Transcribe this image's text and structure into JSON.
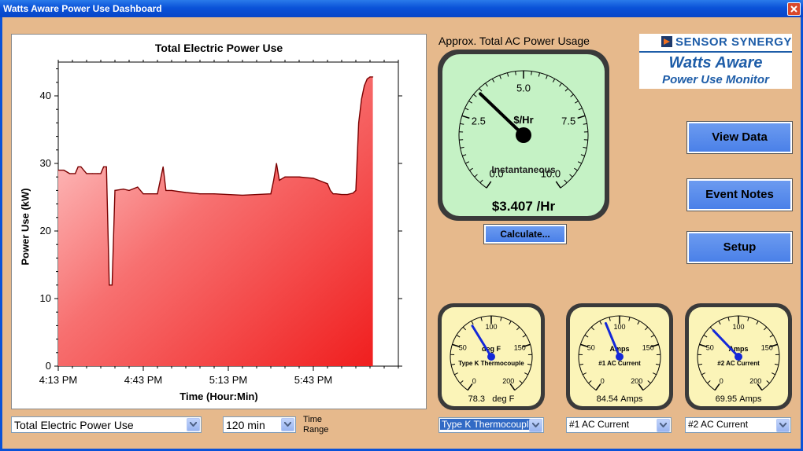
{
  "window": {
    "title": "Watts Aware Power Use Dashboard"
  },
  "chart_data": {
    "type": "area",
    "title": "Total Electric Power Use",
    "xlabel": "Time (Hour:Min)",
    "ylabel": "Power Use (kW)",
    "xticks": [
      "4:13 PM",
      "4:43 PM",
      "5:13 PM",
      "5:43 PM"
    ],
    "yticks": [
      "0",
      "10",
      "20",
      "30",
      "40"
    ],
    "ylim": [
      0,
      45
    ],
    "xlim": [
      0,
      120
    ],
    "grid": false,
    "x": [
      0,
      2,
      4,
      6,
      7,
      8,
      10,
      12,
      14,
      15,
      16,
      17,
      18,
      19,
      20,
      23,
      25,
      28,
      30,
      35,
      37,
      38,
      40,
      45,
      50,
      55,
      60,
      65,
      70,
      75,
      76,
      77,
      78,
      80,
      85,
      90,
      95,
      96,
      97,
      98,
      100,
      102,
      104,
      105,
      106,
      107,
      108,
      109,
      110,
      111
    ],
    "y": [
      29,
      29,
      28.5,
      28.5,
      29.5,
      29.5,
      28.5,
      28.5,
      28.5,
      28.5,
      29.5,
      29.5,
      12,
      12,
      26,
      26.2,
      26,
      26.5,
      25.5,
      25.5,
      29.5,
      26,
      26,
      25.7,
      25.5,
      25.5,
      25.4,
      25.3,
      25.4,
      25.5,
      27.5,
      30,
      27.5,
      28,
      28,
      27.8,
      27,
      26,
      25.5,
      25.5,
      25.4,
      25.4,
      25.6,
      26,
      36,
      39.5,
      41.5,
      42.5,
      42.8,
      42.8
    ]
  },
  "gauge_main": {
    "heading": "Approx. Total AC Power Usage",
    "unit": "$/Hr",
    "caption": "Instantaneous",
    "ticks": [
      "0.0",
      "2.5",
      "5.0",
      "7.5",
      "10.0"
    ],
    "value": 3.407,
    "value_text": "$3.407 /Hr",
    "calculate_label": "Calculate..."
  },
  "logo": {
    "line1": "SENSOR SYNERGY",
    "line2": "Watts Aware",
    "line3": "Power Use Monitor"
  },
  "buttons": {
    "view_data": "View Data",
    "event_notes": "Event Notes",
    "setup": "Setup"
  },
  "small_gauges": [
    {
      "unit": "deg F",
      "label": "Type K Thermocouple",
      "value": 78.3,
      "reading": "78.3",
      "reading_unit": "deg F",
      "select": "Type K Thermocouple"
    },
    {
      "unit": "Amps",
      "label": "#1 AC Current",
      "value": 84.54,
      "reading": "84.54",
      "reading_unit": "Amps",
      "select": "#1 AC Current"
    },
    {
      "unit": "Amps",
      "label": "#2 AC Current",
      "value": 69.95,
      "reading": "69.95",
      "reading_unit": "Amps",
      "select": "#2 AC Current"
    }
  ],
  "small_gauge_ticks": [
    "0",
    "50",
    "100",
    "150",
    "200"
  ],
  "controls": {
    "chart_select": "Total Electric Power Use",
    "range_select": "120 min",
    "range_label_1": "Time",
    "range_label_2": "Range"
  },
  "colors": {
    "background": "#E6B98C",
    "area_fill": "#F03030",
    "gauge_green": "#C5F2C5",
    "gauge_yellow": "#FBF4B8",
    "button_blue": "#4A80E8",
    "needle_blue": "#1428D8"
  }
}
